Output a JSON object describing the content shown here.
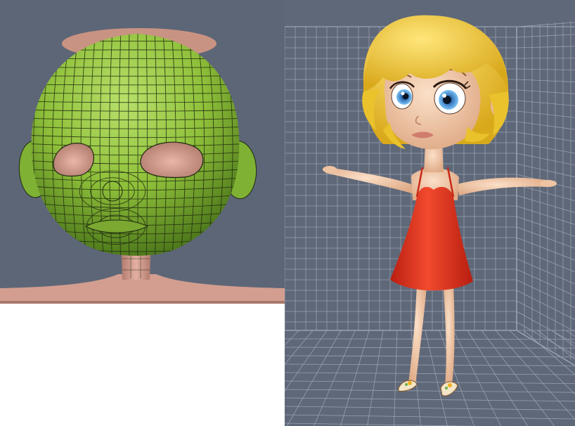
{
  "panels": [
    {
      "id": "face-mesh-view",
      "content": "wireframe-head-mesh",
      "colors": {
        "background": "#5d6677",
        "mesh": "#8fc03a",
        "mesh_lines": "#1e2a10",
        "skin": "#d8a293"
      }
    },
    {
      "id": "character-view",
      "content": "cartoon-girl-t-pose",
      "colors": {
        "background": "#5f6878",
        "grid": "#9aa2b2",
        "hair": "#f2cf35",
        "skin": "#f0c9a8",
        "dress": "#e8321e",
        "eyes": "#5aa8e8"
      }
    }
  ]
}
